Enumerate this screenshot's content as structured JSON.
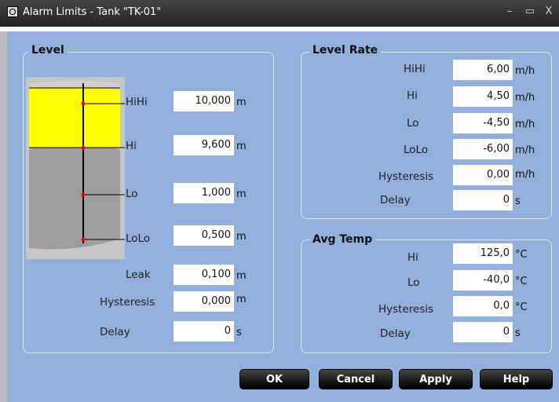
{
  "window": {
    "title": "Alarm Limits - Tank \"TK-01\"",
    "minimize": "–",
    "maximize": "▭",
    "close": "X"
  },
  "level": {
    "group_title": "Level",
    "hihi": {
      "label": "HiHi",
      "value": "10,000",
      "unit": "m"
    },
    "hi": {
      "label": "Hi",
      "value": "9,600",
      "unit": "m"
    },
    "lo": {
      "label": "Lo",
      "value": "1,000",
      "unit": "m"
    },
    "lolo": {
      "label": "LoLo",
      "value": "0,500",
      "unit": "m"
    },
    "leak": {
      "label": "Leak",
      "value": "0,100",
      "unit": "m"
    },
    "hysteresis": {
      "label": "Hysteresis",
      "value": "0,000",
      "unit": "m"
    },
    "delay": {
      "label": "Delay",
      "value": "0",
      "unit": "s"
    }
  },
  "level_rate": {
    "group_title": "Level Rate",
    "hihi": {
      "label": "HiHi",
      "value": "6,00",
      "unit": "m/h"
    },
    "hi": {
      "label": "Hi",
      "value": "4,50",
      "unit": "m/h"
    },
    "lo": {
      "label": "Lo",
      "value": "-4,50",
      "unit": "m/h"
    },
    "lolo": {
      "label": "LoLo",
      "value": "-6,00",
      "unit": "m/h"
    },
    "hysteresis": {
      "label": "Hysteresis",
      "value": "0,00",
      "unit": "m/h"
    },
    "delay": {
      "label": "Delay",
      "value": "0",
      "unit": "s"
    }
  },
  "avg_temp": {
    "group_title": "Avg Temp",
    "hi": {
      "label": "Hi",
      "value": "125,0",
      "unit": "°C"
    },
    "lo": {
      "label": "Lo",
      "value": "-40,0",
      "unit": "°C"
    },
    "hysteresis": {
      "label": "Hysteresis",
      "value": "0,0",
      "unit": "°C"
    },
    "delay": {
      "label": "Delay",
      "value": "0",
      "unit": "s"
    }
  },
  "buttons": {
    "ok": "OK",
    "cancel": "Cancel",
    "apply": "Apply",
    "help": "Help"
  },
  "colors": {
    "background": "#93afdc",
    "liquid": "#ffff00",
    "tank_body": "#9e9e9e",
    "marker": "#ff0000"
  }
}
